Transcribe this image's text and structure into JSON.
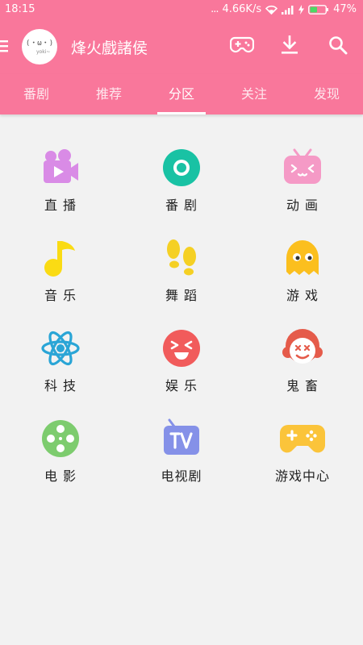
{
  "status_bar": {
    "time": "18:15",
    "dots": "...",
    "speed": "4.66K/s",
    "battery": "47%",
    "battery_level": 0.47
  },
  "toolbar": {
    "avatar_text": "(・ω・)",
    "avatar_subtext": "yoki~",
    "title": "烽火戲諸侯"
  },
  "tabs": [
    {
      "label": "番剧",
      "active": false
    },
    {
      "label": "推荐",
      "active": false
    },
    {
      "label": "分区",
      "active": true
    },
    {
      "label": "关注",
      "active": false
    },
    {
      "label": "发现",
      "active": false
    }
  ],
  "categories": [
    {
      "label": "直 播",
      "icon": "live-camera-icon",
      "color": "#d98be6"
    },
    {
      "label": "番 剧",
      "icon": "bangumi-disc-icon",
      "color": "#19c2a4"
    },
    {
      "label": "动 画",
      "icon": "animation-tv-face-icon",
      "color": "#f59ac6"
    },
    {
      "label": "音 乐",
      "icon": "music-note-icon",
      "color": "#fadb14"
    },
    {
      "label": "舞 蹈",
      "icon": "dance-footprints-icon",
      "color": "#f5d024"
    },
    {
      "label": "游 戏",
      "icon": "game-ghost-icon",
      "color": "#fbbf1e"
    },
    {
      "label": "科 技",
      "icon": "tech-atom-icon",
      "color": "#2aa5d6"
    },
    {
      "label": "娱 乐",
      "icon": "entertainment-laugh-icon",
      "color": "#f15b5b"
    },
    {
      "label": "鬼 畜",
      "icon": "kichiku-clown-icon",
      "color": "#e55b4a"
    },
    {
      "label": "电 影",
      "icon": "movie-reel-icon",
      "color": "#7dcc6e"
    },
    {
      "label": "电视剧",
      "icon": "tv-series-icon",
      "color": "#8591e8"
    },
    {
      "label": "游戏中心",
      "icon": "game-center-controller-icon",
      "color": "#fbc43a"
    }
  ],
  "colors": {
    "brand": "#f9779b",
    "background": "#f2f2f2",
    "text": "#222222"
  }
}
